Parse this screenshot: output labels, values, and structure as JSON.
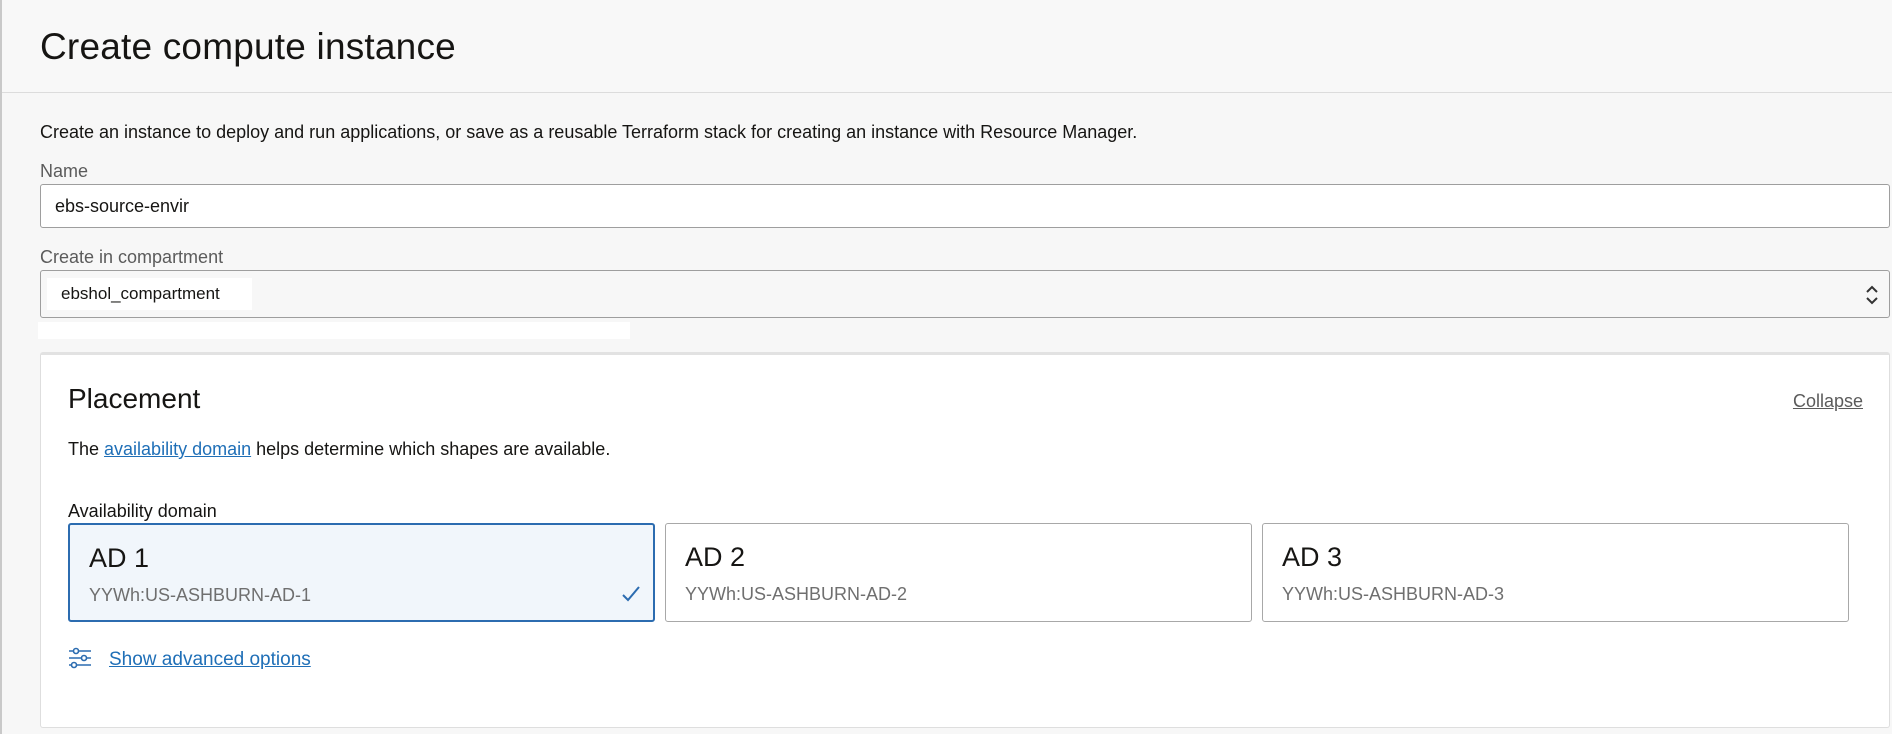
{
  "header": {
    "title": "Create compute instance"
  },
  "intro": "Create an instance to deploy and run applications, or save as a reusable Terraform stack for creating an instance with Resource Manager.",
  "name_field": {
    "label": "Name",
    "value": "ebs-source-envir"
  },
  "compartment_field": {
    "label": "Create in compartment",
    "value": "ebshol_compartment"
  },
  "placement": {
    "title": "Placement",
    "collapse_label": "Collapse",
    "desc_prefix": "The ",
    "desc_link": "availability domain",
    "desc_suffix": " helps determine which shapes are available.",
    "ad_label": "Availability domain",
    "domains": [
      {
        "name": "AD 1",
        "id": "YYWh:US-ASHBURN-AD-1",
        "selected": true
      },
      {
        "name": "AD 2",
        "id": "YYWh:US-ASHBURN-AD-2",
        "selected": false
      },
      {
        "name": "AD 3",
        "id": "YYWh:US-ASHBURN-AD-3",
        "selected": false
      }
    ],
    "advanced_link": "Show advanced options"
  },
  "icons": {
    "select": "chevron-up-down-icon",
    "check": "checkmark-icon",
    "advanced": "sliders-icon"
  },
  "colors": {
    "link": "#1f6fb7",
    "selected_border": "#2c6cb0",
    "selected_bg": "#f1f6fb"
  }
}
